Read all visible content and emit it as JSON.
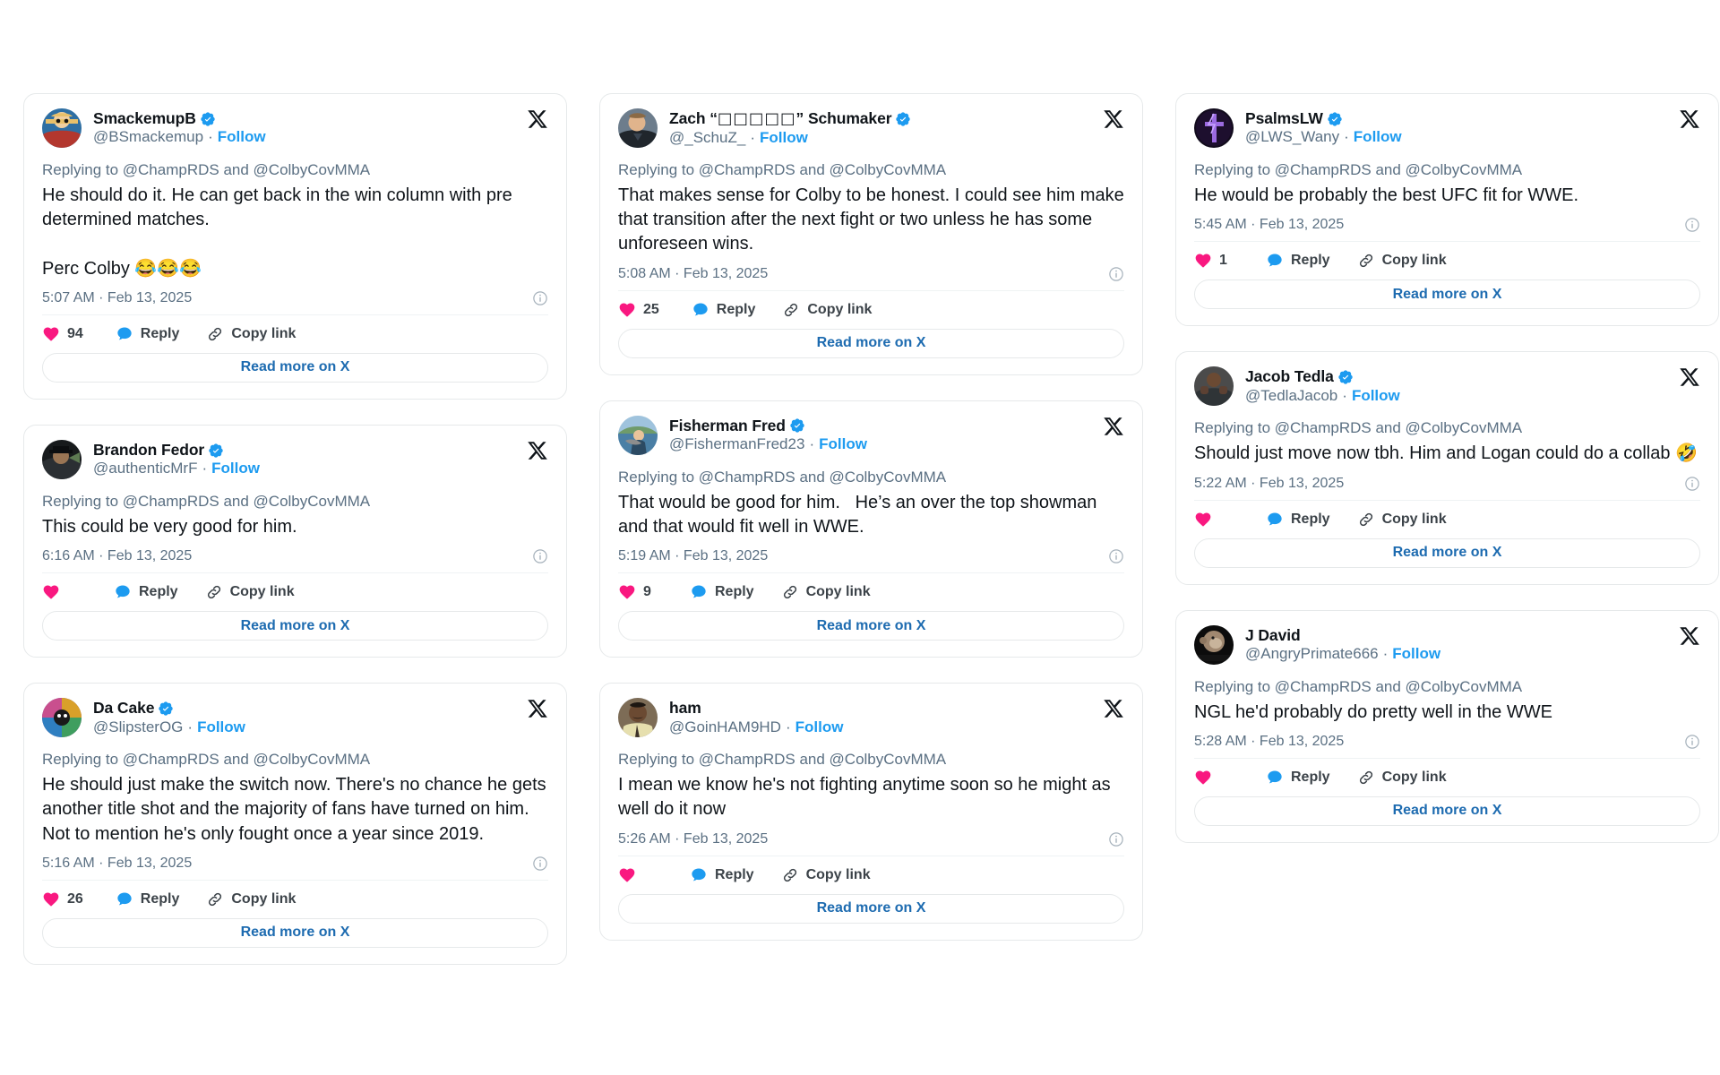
{
  "app": {
    "background": "#ffffff",
    "card_border": "#e6e9ea",
    "accent_blue": "#1d9bf0",
    "link_blue": "#1d6bb0",
    "like_pink": "#f91880",
    "text_primary": "#0f1419",
    "text_secondary": "#5b7083"
  },
  "labels": {
    "follow": "Follow",
    "reply": "Reply",
    "copy_link": "Copy link",
    "read_more": "Read more on X",
    "separator": "·"
  },
  "columns": [
    {
      "id": "column-1",
      "cards": [
        {
          "display_name": "SmackemupB",
          "verified": true,
          "handle": "@BSmackemup",
          "replying_to": "Replying to @ChampRDS and @ColbyCovMMA",
          "text": "He should do it. He can get back in the win column with pre determined matches.\n\nPerc Colby 😂😂😂",
          "timestamp": "5:07 AM · Feb 13, 2025",
          "like_count": "94",
          "avatar_style": "anime-straw-hat"
        },
        {
          "display_name": "Brandon Fedor",
          "verified": true,
          "handle": "@authenticMrF",
          "replying_to": "Replying to @ChampRDS and @ColbyCovMMA",
          "text": "This could be very good for him.",
          "timestamp": "6:16 AM · Feb 13, 2025",
          "like_count": "",
          "avatar_style": "dark-hat-man"
        },
        {
          "display_name": "Da Cake",
          "verified": true,
          "handle": "@SlipsterOG",
          "replying_to": "Replying to @ChampRDS and @ColbyCovMMA",
          "text": "He should just make the switch now. There's no chance he gets another title shot and the majority of fans have turned on him. Not to mention he's only fought once a year since 2019.",
          "timestamp": "5:16 AM · Feb 13, 2025",
          "like_count": "26",
          "avatar_style": "colorful-collage"
        }
      ]
    },
    {
      "id": "column-2",
      "cards": [
        {
          "display_name": "Zach “□□□□□” Schumaker",
          "verified": true,
          "handle": "@_SchuZ_",
          "replying_to": "Replying to @ChampRDS and @ColbyCovMMA",
          "text": "That makes sense for Colby to be honest. I could see him make that transition after the next fight or two unless he has some unforeseen wins.",
          "timestamp": "5:08 AM · Feb 13, 2025",
          "like_count": "25",
          "avatar_style": "man-suit"
        },
        {
          "display_name": "Fisherman Fred",
          "verified": true,
          "handle": "@FishermanFred23",
          "replying_to": "Replying to @ChampRDS and @ColbyCovMMA",
          "text": "That would be good for him.   He’s an over the top showman and that would fit well in WWE.",
          "timestamp": "5:19 AM · Feb 13, 2025",
          "like_count": "9",
          "avatar_style": "lake-fisher"
        },
        {
          "display_name": "ham",
          "verified": false,
          "handle": "@GoinHAM9HD",
          "replying_to": "Replying to @ChampRDS and @ColbyCovMMA",
          "text": "I mean we know he's not fighting anytime soon so he might as well do it now",
          "timestamp": "5:26 AM · Feb 13, 2025",
          "like_count": "",
          "avatar_style": "mustache-man"
        }
      ]
    },
    {
      "id": "column-3",
      "cards": [
        {
          "display_name": "PsalmsLW",
          "verified": true,
          "handle": "@LWS_Wany",
          "replying_to": "Replying to @ChampRDS and @ColbyCovMMA",
          "text": "He would be probably the best UFC fit for WWE.",
          "timestamp": "5:45 AM · Feb 13, 2025",
          "like_count": "1",
          "avatar_style": "purple-cross"
        },
        {
          "display_name": "Jacob Tedla",
          "verified": true,
          "handle": "@TedlaJacob",
          "replying_to": "Replying to @ChampRDS and @ColbyCovMMA",
          "text": "Should just move now tbh. Him and Logan could do a collab 🤣",
          "timestamp": "5:22 AM · Feb 13, 2025",
          "like_count": "",
          "avatar_style": "boxer-man"
        },
        {
          "display_name": "J David",
          "verified": false,
          "handle": "@AngryPrimate666",
          "replying_to": "Replying to @ChampRDS and @ColbyCovMMA",
          "text": "NGL he'd probably do pretty well in the WWE",
          "timestamp": "5:28 AM · Feb 13, 2025",
          "like_count": "",
          "avatar_style": "ape-head"
        }
      ]
    }
  ]
}
